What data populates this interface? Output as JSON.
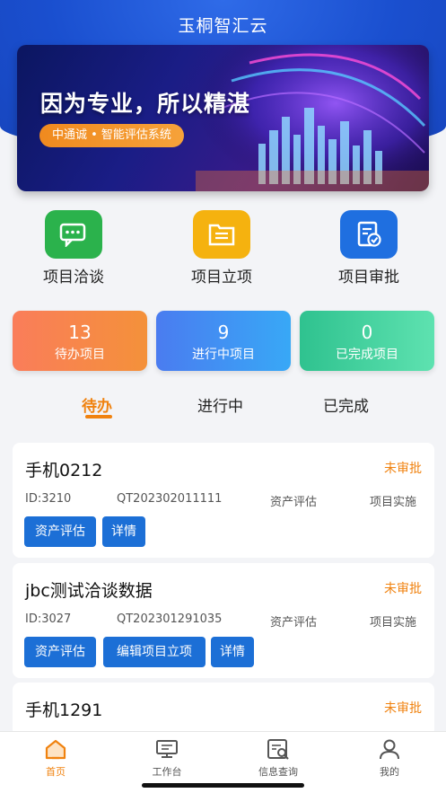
{
  "app": {
    "title": "玉桐智汇云"
  },
  "banner": {
    "headline": "因为专业，所以精湛",
    "tagline": "中通诚 • 智能评估系统"
  },
  "quick_actions": [
    {
      "label": "项目洽谈",
      "icon": "chat-icon",
      "color": "#2bb24c"
    },
    {
      "label": "项目立项",
      "icon": "document-icon",
      "color": "#f5b20f"
    },
    {
      "label": "项目审批",
      "icon": "approval-icon",
      "color": "#1f6fe0"
    }
  ],
  "stats": [
    {
      "count": "13",
      "label": "待办项目"
    },
    {
      "count": "9",
      "label": "进行中项目"
    },
    {
      "count": "0",
      "label": "已完成项目"
    }
  ],
  "tabs": [
    {
      "label": "待办",
      "active": true
    },
    {
      "label": "进行中",
      "active": false
    },
    {
      "label": "已完成",
      "active": false
    }
  ],
  "projects": [
    {
      "title": "手机0212",
      "status": "未审批",
      "id": "ID:3210",
      "code": "QT202302011111",
      "type": "资产评估",
      "stage": "项目实施",
      "buttons": [
        "资产评估",
        "详情"
      ]
    },
    {
      "title": "jbc测试洽谈数据",
      "status": "未审批",
      "id": "ID:3027",
      "code": "QT202301291035",
      "type": "资产评估",
      "stage": "项目实施",
      "buttons": [
        "资产评估",
        "编辑项目立项",
        "详情"
      ]
    },
    {
      "title": "手机1291",
      "status": "未审批"
    }
  ],
  "bottom_nav": [
    {
      "label": "首页",
      "icon": "home-icon",
      "active": true
    },
    {
      "label": "工作台",
      "icon": "monitor-icon",
      "active": false
    },
    {
      "label": "信息查询",
      "icon": "search-doc-icon",
      "active": false
    },
    {
      "label": "我的",
      "icon": "user-icon",
      "active": false
    }
  ],
  "colors": {
    "header_blue": "#1a4fcf",
    "accent_orange": "#f0820f",
    "button_blue": "#1c6fd6",
    "stat_orange": "#f6804f",
    "stat_blue": "#3d7ff0",
    "stat_green": "#3ccf9a"
  }
}
